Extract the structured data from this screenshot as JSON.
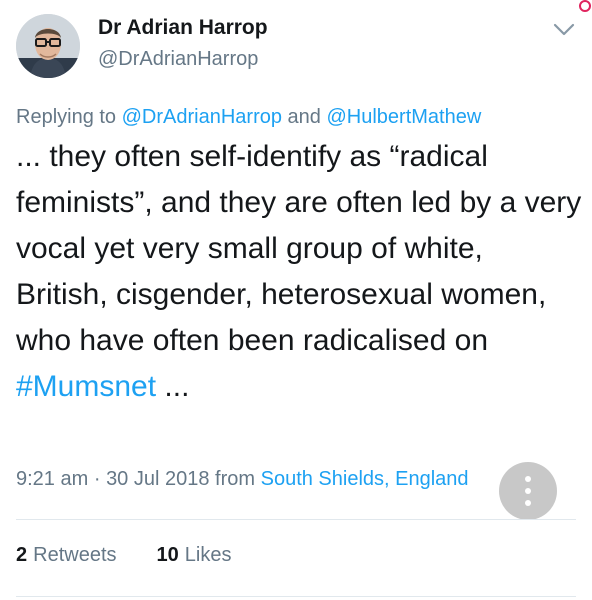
{
  "author": {
    "name": "Dr Adrian Harrop",
    "handle": "@DrAdrianHarrop"
  },
  "reply": {
    "prefix": "Replying to",
    "mention1": "@DrAdrianHarrop",
    "joiner": "and",
    "mention2": "@HulbertMathew"
  },
  "tweet": {
    "text": "... they often self-identify as “radical feminists”, and they are often led by a very vocal yet very small group of white, British, cisgender, heterosexual women, who have often been radicalised on ",
    "hashtag": "#Mumsnet",
    "suffix": " ..."
  },
  "meta": {
    "time": "9:21 am",
    "separator": "·",
    "date": "30 Jul 2018",
    "from_label": "from",
    "location": "South Shields, England"
  },
  "stats": {
    "retweets_count": "2",
    "retweets_label": "Retweets",
    "likes_count": "10",
    "likes_label": "Likes"
  },
  "icons": {
    "caret": "chevron-down-icon",
    "more": "more-vertical-icon"
  },
  "colors": {
    "link": "#1da1f2",
    "secondary_text": "#657786",
    "primary_text": "#14171a",
    "divider": "#e1e8ed"
  }
}
